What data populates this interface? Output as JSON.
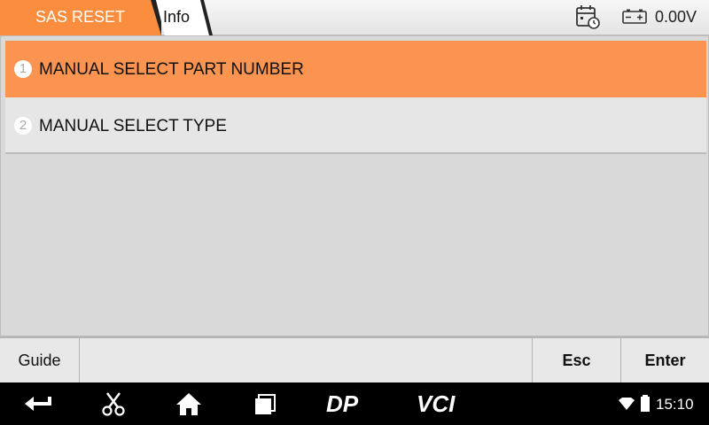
{
  "header": {
    "breadcrumb": [
      "SAS RESET",
      "Info"
    ],
    "voltage": "0.00V",
    "accent_color": "#fb8d3e"
  },
  "menu": {
    "items": [
      {
        "number": "1",
        "label": "MANUAL SELECT PART NUMBER",
        "selected": true
      },
      {
        "number": "2",
        "label": "MANUAL SELECT TYPE",
        "selected": false
      }
    ]
  },
  "footer": {
    "guide_label": "Guide",
    "esc_label": "Esc",
    "enter_label": "Enter"
  },
  "navbar": {
    "icons": [
      "back-icon",
      "scissors-icon",
      "home-icon",
      "recent-apps-icon",
      "dp-icon",
      "vci-icon"
    ],
    "dp_text": "DP",
    "vci_text": "VCI",
    "time": "15:10"
  }
}
